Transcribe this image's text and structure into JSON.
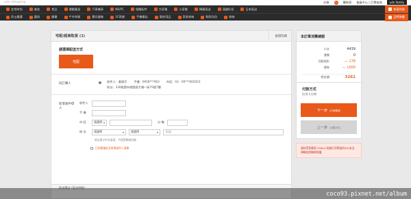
{
  "topbar": {
    "brand": "udn shopping",
    "login": "註冊",
    "cart_count": "1",
    "cart_label": "購物車",
    "member": "會員中心 | 訂單查詢",
    "family": "udn family"
  },
  "nav": {
    "row1": [
      "女性時尚",
      "美妝",
      "食品",
      "運動健身",
      "汽車機車",
      "NB/PC",
      "相機配件",
      "大家電",
      "小家電",
      "韓國直送",
      "滿額折扣",
      "日本直送"
    ],
    "row2": [
      "男士嚴選",
      "寢具",
      "圖書",
      "戶外休閒",
      "嬰兒童裝",
      "3C周邊",
      "手機電玩",
      "廚房用品",
      "家具收納",
      "鞋款包包",
      "收納"
    ],
    "hl1": "快速到貨",
    "hl2": "品牌旗艦"
  },
  "main": {
    "section_title": "宅配/超商取貨 (1)",
    "toggle": "展開明細",
    "delivery_label": "請選擇配送方式",
    "delivery_btn": "宅配",
    "buyer_label": "同訂購人",
    "buyer_line1_name": "收件人：黃郁芬",
    "buyer_line1_phone": "手機：0958***903",
    "buyer_line1_tel": "市話：03 - 09***600503",
    "buyer_line2": "地址：330桃園市桃園區大埔一街79號7樓",
    "new_label": "新增收件人",
    "f_name": "收件人",
    "f_mobile": "手 機",
    "f_tel": "市 話",
    "f_tel_sel": "請選擇",
    "f_ext": "分 機",
    "f_addr": "地 址",
    "f_addr_sel": "請選擇",
    "f_addr_sel2": "請選擇",
    "f_addr_ph": "街道",
    "addr_note": "地址請以中文填寫，不接受郵政信箱",
    "save_chk": "已同意儲存至常用收件人清單",
    "sec2": "配送備註 (配送時間)"
  },
  "side": {
    "title": "本訂單消費總額",
    "rows": [
      {
        "k": "小計",
        "v": "4439"
      },
      {
        "k": "運費",
        "v": "0"
      },
      {
        "k": "活動現折",
        "v": "— 178"
      },
      {
        "k": "禮券",
        "v": "— 1000"
      }
    ],
    "total_k": "總金額",
    "total_v": "3261",
    "pay_title": "付款方式",
    "pay_val": "信用卡分期",
    "next": "下一步",
    "next_sub": "(訂單確認)",
    "prev": "上一步",
    "prev_sub": "(付款方式)",
    "secure": "資料受到最高 256bit 與銀行同等級的SSL安全傳輸加密機制保護"
  },
  "watermark": "coco93.pixnet.net/album"
}
